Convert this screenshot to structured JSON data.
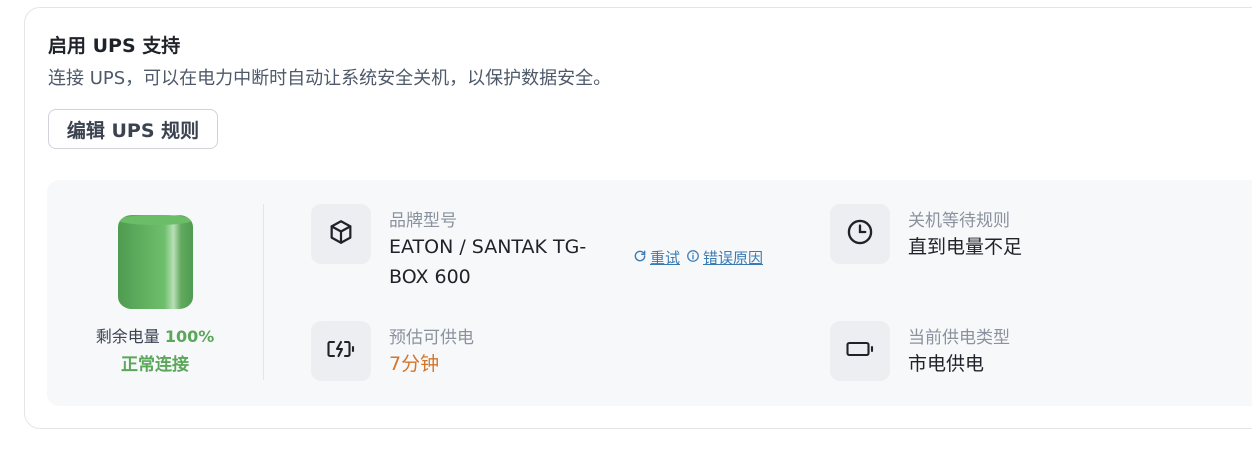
{
  "section": {
    "title": "启用 UPS 支持",
    "description": "连接 UPS，可以在电力中断时自动让系统安全关机，以保护数据安全。",
    "edit_button": "编辑 UPS 规则"
  },
  "status": {
    "remaining_label": "剩余电量",
    "remaining_percent": "100%",
    "connection": "正常连接",
    "battery_color": "#5aa75a"
  },
  "info": {
    "model": {
      "icon": "box-icon",
      "label": "品牌型号",
      "value_line1": "EATON / SANTAK TG-",
      "value_line2": "BOX 600",
      "retry_label": "重试",
      "error_reason_label": "错误原因"
    },
    "shutdown_rule": {
      "icon": "clock-icon",
      "label": "关机等待规则",
      "value": "直到电量不足"
    },
    "runtime": {
      "icon": "battery-charging-icon",
      "label": "预估可供电",
      "value": "7分钟",
      "value_color": "#d4752b"
    },
    "power_source": {
      "icon": "battery-icon",
      "label": "当前供电类型",
      "value": "市电供电"
    }
  }
}
